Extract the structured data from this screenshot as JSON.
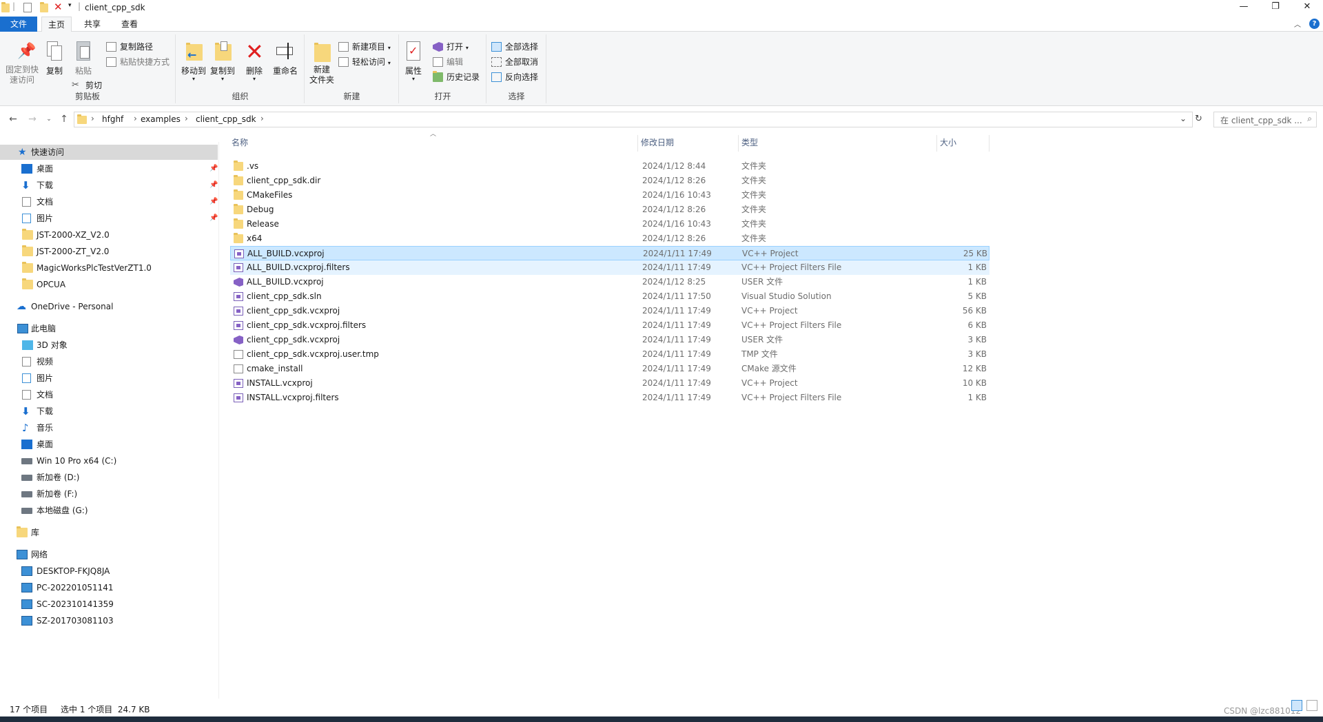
{
  "window": {
    "title": "client_cpp_sdk",
    "controls": {
      "minimize": "—",
      "maximize": "❐",
      "close": "✕"
    }
  },
  "ribbon_tabs": [
    "文件",
    "主页",
    "共享",
    "查看"
  ],
  "ribbon": {
    "clipboard": {
      "pin_quick": "固定到快\n速访问",
      "copy": "复制",
      "paste": "粘贴",
      "copy_path": "复制路径",
      "paste_shortcut": "粘贴快捷方式",
      "cut": "剪切",
      "group_label": "剪贴板"
    },
    "organize": {
      "move_to": "移动到",
      "copy_to": "复制到",
      "delete": "删除",
      "rename": "重命名",
      "group_label": "组织"
    },
    "new": {
      "new_folder": "新建\n文件夹",
      "new_item": "新建项目",
      "easy_access": "轻松访问",
      "group_label": "新建"
    },
    "open": {
      "properties": "属性",
      "open": "打开",
      "edit": "编辑",
      "history": "历史记录",
      "group_label": "打开"
    },
    "select": {
      "select_all": "全部选择",
      "select_none": "全部取消",
      "invert": "反向选择",
      "group_label": "选择"
    }
  },
  "address": {
    "crumbs": [
      "hfghf",
      "examples",
      "client_cpp_sdk"
    ],
    "search_placeholder": "在 client_cpp_sdk ..."
  },
  "sidebar": {
    "quick_access": "快速访问",
    "quick_items": [
      "桌面",
      "下载",
      "文档",
      "图片",
      "JST-2000-XZ_V2.0",
      "JST-2000-ZT_V2.0",
      "MagicWorksPlcTestVerZT1.0",
      "OPCUA"
    ],
    "onedrive": "OneDrive - Personal",
    "this_pc": "此电脑",
    "pc_items": [
      "3D 对象",
      "视频",
      "图片",
      "文档",
      "下载",
      "音乐",
      "桌面",
      "Win 10 Pro x64 (C:)",
      "新加卷 (D:)",
      "新加卷 (F:)",
      "本地磁盘 (G:)"
    ],
    "library": "库",
    "network": "网络",
    "network_items": [
      "DESKTOP-FKJQ8JA",
      "PC-202201051141",
      "SC-202310141359",
      "SZ-201703081103"
    ]
  },
  "columns": {
    "name": "名称",
    "date": "修改日期",
    "type": "类型",
    "size": "大小"
  },
  "files": [
    {
      "icon": "folder",
      "name": ".vs",
      "date": "2024/1/12 8:44",
      "type": "文件夹",
      "size": ""
    },
    {
      "icon": "folder",
      "name": "client_cpp_sdk.dir",
      "date": "2024/1/12 8:26",
      "type": "文件夹",
      "size": ""
    },
    {
      "icon": "folder",
      "name": "CMakeFiles",
      "date": "2024/1/16 10:43",
      "type": "文件夹",
      "size": ""
    },
    {
      "icon": "folder",
      "name": "Debug",
      "date": "2024/1/12 8:26",
      "type": "文件夹",
      "size": ""
    },
    {
      "icon": "folder",
      "name": "Release",
      "date": "2024/1/16 10:43",
      "type": "文件夹",
      "size": ""
    },
    {
      "icon": "folder",
      "name": "x64",
      "date": "2024/1/12 8:26",
      "type": "文件夹",
      "size": ""
    },
    {
      "icon": "vcxproj",
      "name": "ALL_BUILD.vcxproj",
      "date": "2024/1/11 17:49",
      "type": "VC++ Project",
      "size": "25 KB",
      "state": "selected"
    },
    {
      "icon": "filters",
      "name": "ALL_BUILD.vcxproj.filters",
      "date": "2024/1/11 17:49",
      "type": "VC++ Project Filters File",
      "size": "1 KB",
      "state": "hover"
    },
    {
      "icon": "vs",
      "name": "ALL_BUILD.vcxproj",
      "date": "2024/1/12 8:25",
      "type": "USER 文件",
      "size": "1 KB"
    },
    {
      "icon": "sln",
      "name": "client_cpp_sdk.sln",
      "date": "2024/1/11 17:50",
      "type": "Visual Studio Solution",
      "size": "5 KB"
    },
    {
      "icon": "vcxproj",
      "name": "client_cpp_sdk.vcxproj",
      "date": "2024/1/11 17:49",
      "type": "VC++ Project",
      "size": "56 KB"
    },
    {
      "icon": "filters",
      "name": "client_cpp_sdk.vcxproj.filters",
      "date": "2024/1/11 17:49",
      "type": "VC++ Project Filters File",
      "size": "6 KB"
    },
    {
      "icon": "vs",
      "name": "client_cpp_sdk.vcxproj",
      "date": "2024/1/11 17:49",
      "type": "USER 文件",
      "size": "3 KB"
    },
    {
      "icon": "doc",
      "name": "client_cpp_sdk.vcxproj.user.tmp",
      "date": "2024/1/11 17:49",
      "type": "TMP 文件",
      "size": "3 KB"
    },
    {
      "icon": "doc",
      "name": "cmake_install",
      "date": "2024/1/11 17:49",
      "type": "CMake 源文件",
      "size": "12 KB"
    },
    {
      "icon": "vcxproj",
      "name": "INSTALL.vcxproj",
      "date": "2024/1/11 17:49",
      "type": "VC++ Project",
      "size": "10 KB"
    },
    {
      "icon": "filters",
      "name": "INSTALL.vcxproj.filters",
      "date": "2024/1/11 17:49",
      "type": "VC++ Project Filters File",
      "size": "1 KB"
    }
  ],
  "status": {
    "count": "17 个项目",
    "selection": "选中 1 个项目  24.7 KB",
    "watermark": "CSDN @lzc881012"
  },
  "colors": {
    "accent": "#1a6fcf",
    "selected": "#cce8ff",
    "hover": "#e5f3ff"
  }
}
